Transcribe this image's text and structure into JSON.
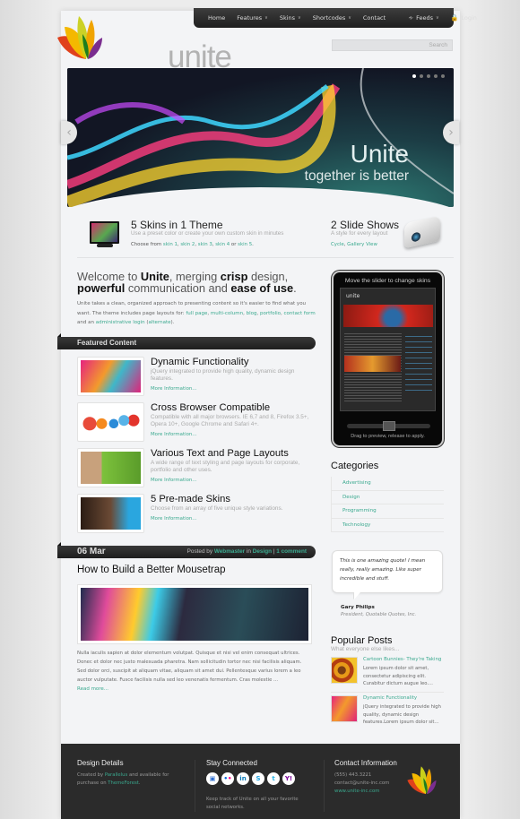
{
  "nav": {
    "items": [
      {
        "label": "Home"
      },
      {
        "label": "Features",
        "dropdown": true
      },
      {
        "label": "Skins",
        "dropdown": true
      },
      {
        "label": "Shortcodes",
        "dropdown": true
      },
      {
        "label": "Contact"
      }
    ],
    "feeds_label": "Feeds",
    "login_label": "Login"
  },
  "logo": {
    "text": "unite"
  },
  "search": {
    "placeholder": "Search"
  },
  "slider": {
    "title": "Unite",
    "subtitle": "together is better",
    "slide_count": 5,
    "active_slide": 1
  },
  "features_strip": {
    "skins": {
      "title": "5 Skins in 1 Theme",
      "subtitle": "Use a preset color or create your own custom skin in minutes",
      "choose_prefix": "Choose from",
      "links": [
        "skin 1",
        "skin 2",
        "skin 3",
        "skin 4",
        "skin 5"
      ],
      "or_text": "or"
    },
    "slideshows": {
      "title": "2 Slide Shows",
      "subtitle": "A style for every layout",
      "links": [
        "Cycle",
        "Gallery View"
      ]
    }
  },
  "welcome": {
    "parts": [
      "Welcome to ",
      "Unite",
      ", merging ",
      "crisp",
      " design, ",
      "powerful",
      " communication and ",
      "ease of use",
      "."
    ],
    "intro_prefix": "Unite takes a clean, organized approach to presenting content so it's easier to find what you want. The theme includes page layouts for:",
    "intro_links": [
      "full page",
      "multi-column",
      "blog",
      "portfolio",
      "contact form",
      "administrative login",
      "alternate"
    ],
    "intro_and": "and an"
  },
  "featured": {
    "heading": "Featured Content",
    "more_label": "More Information...",
    "items": [
      {
        "title": "Dynamic Functionality",
        "desc": "jQuery integrated to provide high quality, dynamic design features."
      },
      {
        "title": "Cross Browser Compatible",
        "desc": "Compatible with all major browsers. IE 6,7 and 8, Firefox 3.5+, Opera 10+, Google Chrome and Safari 4+."
      },
      {
        "title": "Various Text and Page Layouts",
        "desc": "A wide range of text styling and page layouts for corporate, portfolio and other uses."
      },
      {
        "title": "5 Pre-made Skins",
        "desc": "Choose from an array of five unique style variations."
      }
    ]
  },
  "post": {
    "date": "06 Mar",
    "posted_by": "Posted by",
    "author": "Webmaster",
    "in_text": "in",
    "category": "Design",
    "comments": "1 comment",
    "title": "How to Build a Better Mousetrap",
    "excerpt": "Nulla iaculis sapien at dolor elementum volutpat. Quisque et nisi vel enim consequat ultrices. Donec et dolor nec justo malesuada pharetra. Nam sollicitudin tortor nec nisi facilisis aliquam. Sed dolor orci, suscipit at aliquam vitae, aliquam sit amet dui. Pellentesque varius lorem a leo auctor vulputate. Fusce facilisis nulla sed leo venenatis fermentum. Cras molestie ...",
    "read_more": "Read more..."
  },
  "skin_preview": {
    "caption": "Move the slider to change skins",
    "hint": "Drag to preview, release to apply.",
    "screen_logo": "unite"
  },
  "categories": {
    "heading": "Categories",
    "items": [
      "Advertising",
      "Design",
      "Programming",
      "Technology"
    ]
  },
  "quote": {
    "text": "This is one amazing quote! I mean really, really amazing. Like super incredible and stuff.",
    "name": "Gary Philips",
    "role": "President, Quotable Quotes, Inc."
  },
  "popular": {
    "heading": "Popular Posts",
    "subtitle": "What everyone else likes...",
    "items": [
      {
        "title": "Cartoon Bunnies- They're Taking",
        "desc": "Lorem ipsum dolor sit amet, consectetur adipiscing elit. Curabitur dictum augue leo...."
      },
      {
        "title": "Dynamic Functionality",
        "desc": "jQuery integrated to provide high quality, dynamic design features.Lorem ipsum dolor sit..."
      }
    ]
  },
  "footer": {
    "design": {
      "heading": "Design Details",
      "line1_prefix": "Created by",
      "author_link": "Parallelus",
      "line1_suffix": "and available for",
      "line2_prefix": "purchase on",
      "store_link": "ThemeForest",
      "line2_suffix": "."
    },
    "social": {
      "heading": "Stay Connected",
      "icons": [
        "delicious",
        "flickr",
        "linkedin",
        "skype",
        "twitter",
        "yahoo"
      ],
      "text_line1": "Keep track of Unite on all your favorite",
      "text_line2": "social networks."
    },
    "contact": {
      "heading": "Contact Information",
      "phone": "(555) 443.3221",
      "email": "contact@unite-inc.com",
      "website": "www.unite-inc.com"
    }
  }
}
